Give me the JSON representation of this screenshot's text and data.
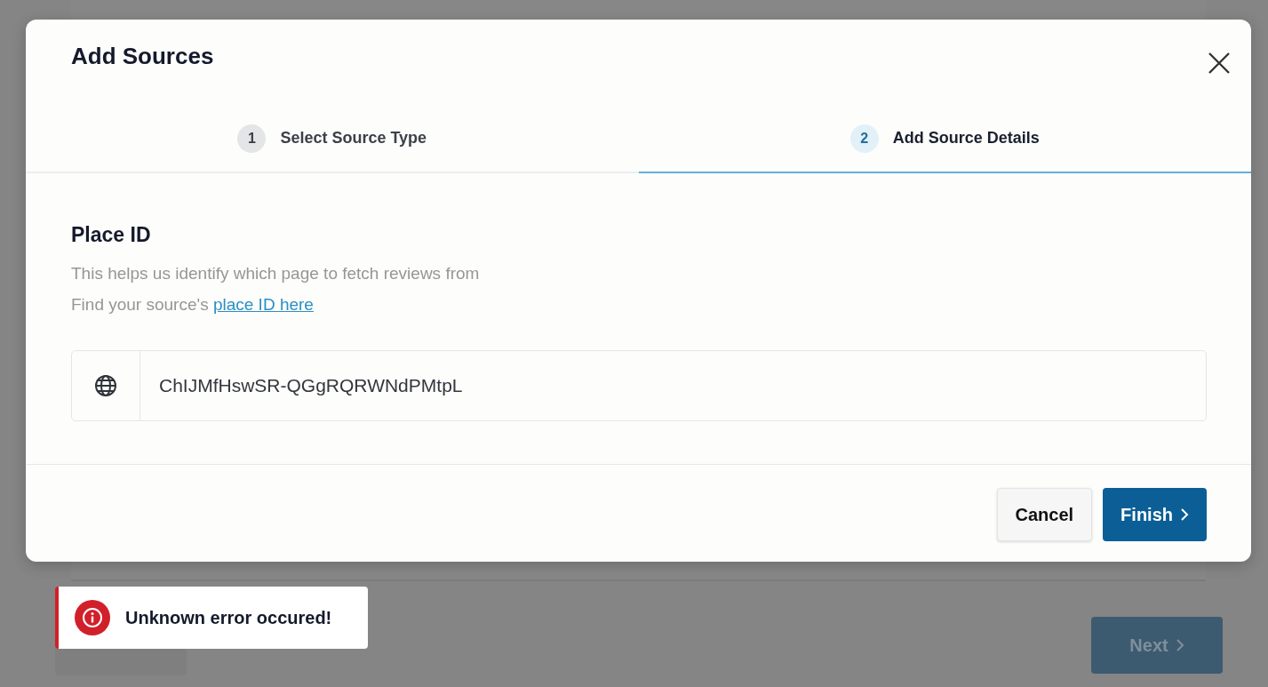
{
  "background_page": {
    "next_button": {
      "label": "Next",
      "disabled": true
    }
  },
  "dialog": {
    "title": "Add Sources",
    "steps": [
      {
        "number": "1",
        "label": "Select Source Type",
        "selected": false
      },
      {
        "number": "2",
        "label": "Add Source Details",
        "selected": true
      }
    ],
    "field": {
      "title": "Place ID",
      "help": "This helps us identify which page to fetch reviews from",
      "link_prefix": "Find your source's ",
      "link": "place ID here",
      "value": "ChIJMfHswSR-QGgRQRWNdPMtpL"
    },
    "buttons": [
      {
        "label": "Cancel",
        "kind": "secondary"
      },
      {
        "label": "Finish",
        "kind": "primary"
      }
    ]
  },
  "toast": {
    "message": "Unknown error occured!",
    "kind": "error"
  }
}
